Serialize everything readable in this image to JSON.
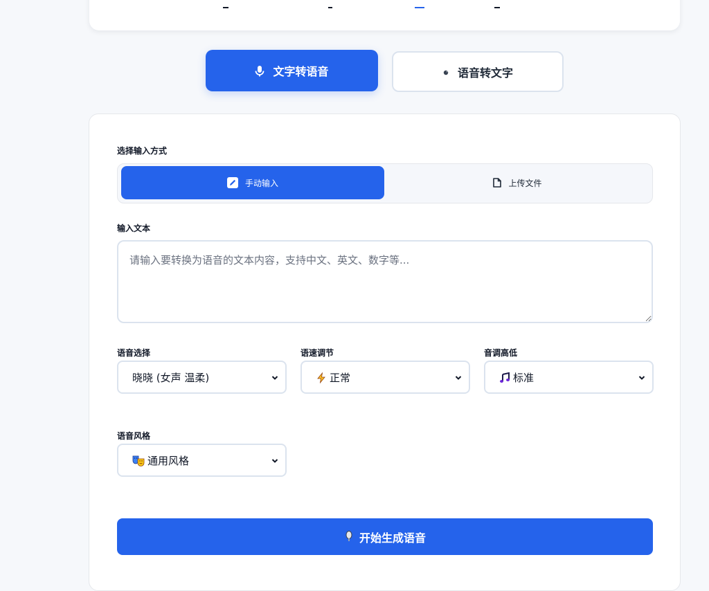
{
  "mode_tabs": {
    "text_to_speech": "文字转语音",
    "speech_to_text": "语音转文字"
  },
  "input_method": {
    "label": "选择输入方式",
    "manual": "手动输入",
    "upload": "上传文件"
  },
  "text_input": {
    "label": "输入文本",
    "placeholder": "请输入要转换为语音的文本内容，支持中文、英文、数字等..."
  },
  "voice_select": {
    "label": "语音选择",
    "value": "晓晓 (女声 温柔)"
  },
  "speed_select": {
    "label": "语速调节",
    "icon": "⚡",
    "value": "正常"
  },
  "pitch_select": {
    "label": "音调高低",
    "icon": "🎵",
    "value": "标准"
  },
  "style_select": {
    "label": "语音风格",
    "icon": "🎭",
    "value": "通用风格"
  },
  "generate_button": {
    "label": "开始生成语音"
  },
  "colors": {
    "primary": "#2563eb",
    "border": "#dbe3ee",
    "background": "#f6f8fb"
  }
}
